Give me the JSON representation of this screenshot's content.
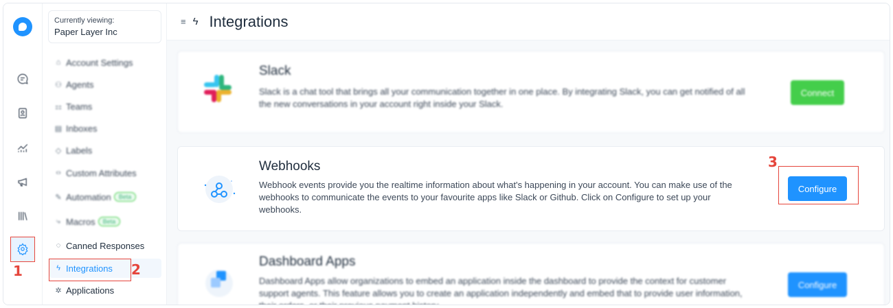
{
  "account": {
    "viewing_label": "Currently viewing:",
    "name": "Paper Layer Inc"
  },
  "rail": {
    "icons": [
      "conversations-icon",
      "contacts-icon",
      "reports-icon",
      "campaigns-icon",
      "library-icon",
      "settings-icon"
    ]
  },
  "sidebar": {
    "items": [
      {
        "label": "Account Settings",
        "icon": "⌂"
      },
      {
        "label": "Agents",
        "icon": "⚇"
      },
      {
        "label": "Teams",
        "icon": "⚏"
      },
      {
        "label": "Inboxes",
        "icon": "▤"
      },
      {
        "label": "Labels",
        "icon": "◇"
      },
      {
        "label": "Custom Attributes",
        "icon": "‹›"
      },
      {
        "label": "Automation",
        "icon": "✎",
        "badge": "Beta"
      },
      {
        "label": "Macros",
        "icon": "⤷",
        "badge": "Beta"
      },
      {
        "label": "Canned Responses",
        "icon": "◌"
      },
      {
        "label": "Integrations",
        "icon": "ϟ"
      },
      {
        "label": "Applications",
        "icon": "✲"
      }
    ]
  },
  "header": {
    "title": "Integrations"
  },
  "integrations": [
    {
      "title": "Slack",
      "description": "Slack is a chat tool that brings all your communication together in one place. By integrating Slack, you can get notified of all the new conversations in your account right inside your Slack.",
      "button": "Connect"
    },
    {
      "title": "Webhooks",
      "description": "Webhook events provide you the realtime information about what's happening in your account. You can make use of the webhooks to communicate the events to your favourite apps like Slack or Github. Click on Configure to set up your webhooks.",
      "button": "Configure"
    },
    {
      "title": "Dashboard Apps",
      "description": "Dashboard Apps allow organizations to embed an application inside the dashboard to provide the context for customer support agents. This feature allows you to create an application independently and embed that to provide user information, their orders, or their previous payment history.",
      "button": "Configure"
    }
  ],
  "annotations": [
    "1",
    "2",
    "3"
  ],
  "colors": {
    "primary": "#1f93ff",
    "success": "#44ce4b",
    "annotation": "#e5453b"
  }
}
